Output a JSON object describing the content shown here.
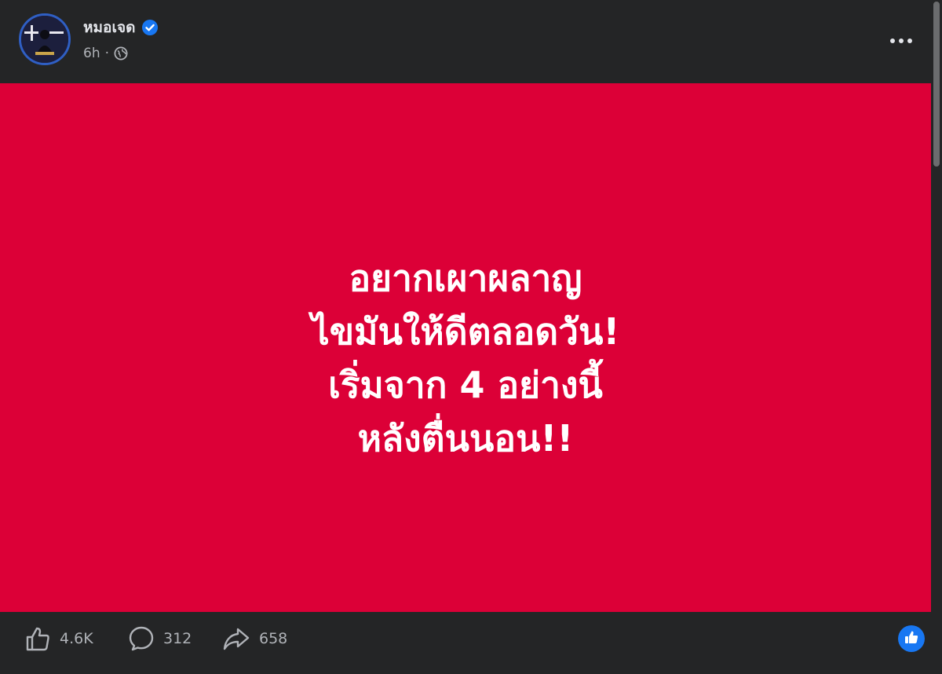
{
  "post": {
    "author_name": "หมอเจด",
    "time": "6h",
    "separator": "·",
    "privacy_icon": "globe-icon",
    "verified_icon": "verified-badge-icon",
    "more_icon": "more-options-icon"
  },
  "image": {
    "background_color": "#dc0037",
    "lines": [
      "อยากเผาผลาญ",
      "ไขมันให้ดีตลอดวัน!",
      "เริ่มจาก 4 อย่างนี้",
      "หลังตื่นนอน!!"
    ]
  },
  "actions": {
    "like_count": "4.6K",
    "comment_count": "312",
    "share_count": "658"
  },
  "colors": {
    "surface": "#242526",
    "accent": "#1877f2",
    "text_secondary": "#b0b3b8"
  }
}
